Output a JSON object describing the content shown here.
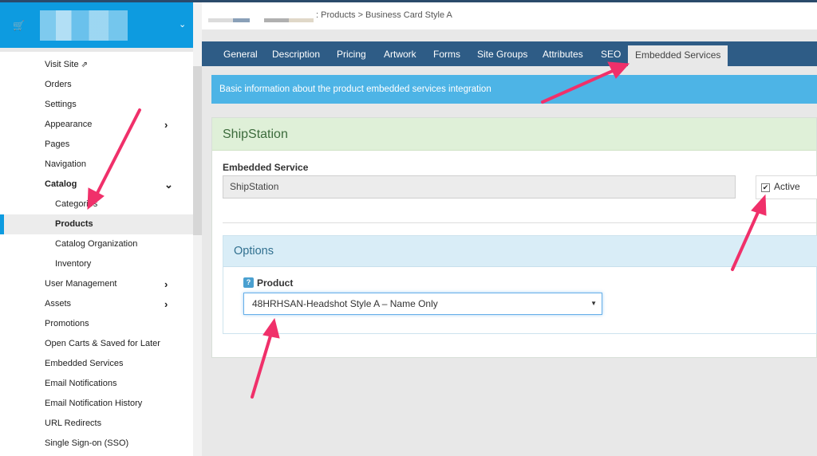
{
  "sidebar": {
    "items": [
      {
        "label": "Visit Site",
        "level": 1,
        "ext": true
      },
      {
        "label": "Orders",
        "level": 1
      },
      {
        "label": "Settings",
        "level": 1
      },
      {
        "label": "Appearance",
        "level": 1,
        "arrow": "right"
      },
      {
        "label": "Pages",
        "level": 1
      },
      {
        "label": "Navigation",
        "level": 1
      },
      {
        "label": "Catalog",
        "level": 1,
        "bold": true,
        "arrow": "down"
      },
      {
        "label": "Categories",
        "level": 2
      },
      {
        "label": "Products",
        "level": 2,
        "active": true
      },
      {
        "label": "Catalog Organization",
        "level": 2
      },
      {
        "label": "Inventory",
        "level": 2
      },
      {
        "label": "User Management",
        "level": 1,
        "arrow": "right"
      },
      {
        "label": "Assets",
        "level": 1,
        "arrow": "right"
      },
      {
        "label": "Promotions",
        "level": 1
      },
      {
        "label": "Open Carts & Saved for Later",
        "level": 1
      },
      {
        "label": "Embedded Services",
        "level": 1
      },
      {
        "label": "Email Notifications",
        "level": 1
      },
      {
        "label": "Email Notification History",
        "level": 1
      },
      {
        "label": "URL Redirects",
        "level": 1
      },
      {
        "label": "Single Sign-on (SSO)",
        "level": 1
      }
    ]
  },
  "breadcrumb": {
    "text": ": Products > Business Card Style A"
  },
  "tabs": [
    {
      "label": "General"
    },
    {
      "label": "Description"
    },
    {
      "label": "Pricing"
    },
    {
      "label": "Artwork"
    },
    {
      "label": "Forms"
    },
    {
      "label": "Site Groups"
    },
    {
      "label": "Attributes"
    },
    {
      "label": "SEO"
    },
    {
      "label": "Embedded Services",
      "active": true
    }
  ],
  "info": {
    "text": "Basic information about the product embedded services integration"
  },
  "panel": {
    "title": "ShipStation",
    "service_label": "Embedded Service",
    "service_value": "ShipStation",
    "active_label": "Active",
    "active_checked": true
  },
  "options": {
    "title": "Options",
    "help_glyph": "?",
    "product_label": "Product",
    "product_value": "48HRHSAN-Headshot Style A – Name Only"
  },
  "colors": {
    "brand": "#0d9be0",
    "tabbar": "#2e5c86",
    "info": "#4db4e6",
    "success_head": "#dff0d8",
    "info_head": "#d9edf7",
    "arrow": "#f0306a"
  }
}
